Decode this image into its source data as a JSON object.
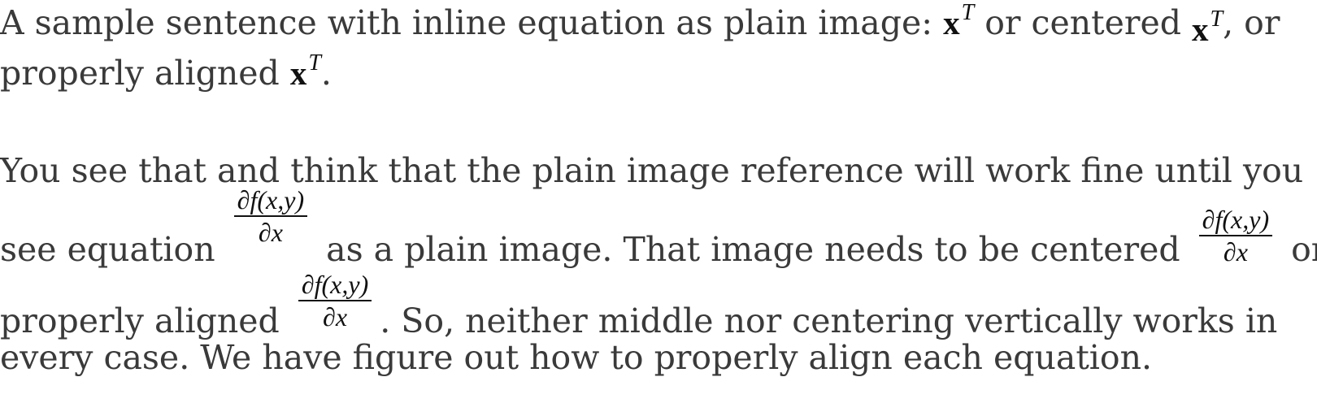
{
  "p1": {
    "l1_a": "A sample sentence with inline equation as plain image: ",
    "l1_b": " or centered ",
    "l1_c": ", or",
    "l2_a": "properly aligned ",
    "l2_b": "."
  },
  "math": {
    "vec": "x",
    "sup": "T",
    "frac_num": "∂f(x,y)",
    "frac_den": "∂x"
  },
  "p2": {
    "l1": "You see that and think that the plain image reference will work fine until you",
    "l2_a": "see equation ",
    "l2_b": " as a plain image. That image needs to be centered ",
    "l2_c": " or",
    "l3_a": "properly aligned ",
    "l3_b": ". So, neither middle nor centering vertically works in",
    "l4": "every case. We have figure out how to properly align each equation."
  }
}
